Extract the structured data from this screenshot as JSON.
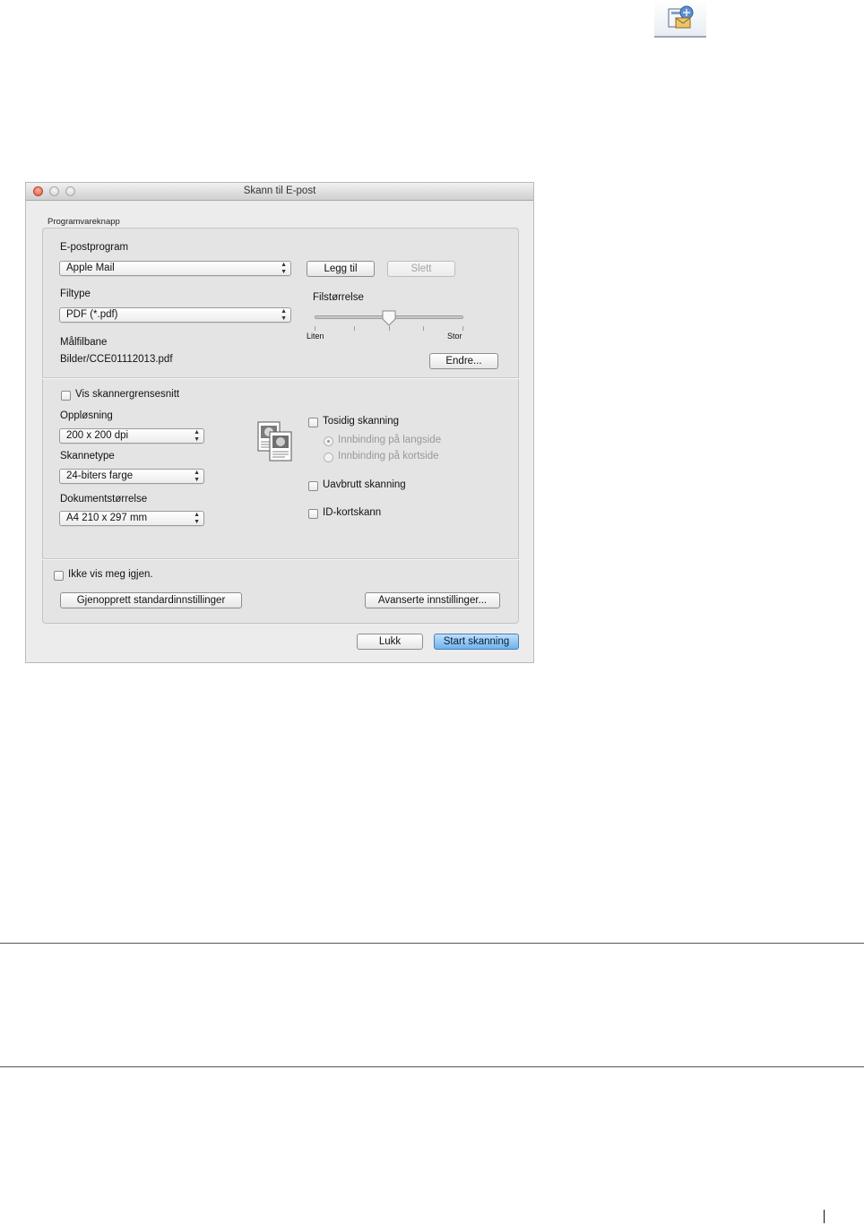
{
  "dialog": {
    "title": "Skann til E-post",
    "group_label": "Programvareknapp",
    "email_program": {
      "label": "E-postprogram",
      "value": "Apple Mail",
      "add_button": "Legg til",
      "delete_button": "Slett"
    },
    "file_type": {
      "label": "Filtype",
      "value": "PDF (*.pdf)"
    },
    "file_size": {
      "label": "Filstørrelse",
      "min_label": "Liten",
      "max_label": "Stor",
      "level_fraction": 0.5
    },
    "target_path": {
      "label": "Målfilbane",
      "value": "Bilder/CCE01112013.pdf",
      "change_button": "Endre..."
    },
    "show_scanner_interface": {
      "label": "Vis skannergrensesnitt",
      "checked": false
    },
    "resolution": {
      "label": "Oppløsning",
      "value": "200 x 200 dpi"
    },
    "scan_type": {
      "label": "Skannetype",
      "value": "24-biters farge"
    },
    "document_size": {
      "label": "Dokumentstørrelse",
      "value": "A4 210 x 297 mm"
    },
    "duplex": {
      "label": "Tosidig skanning",
      "checked": false,
      "long_edge": "Innbinding på langside",
      "short_edge": "Innbinding på kortside"
    },
    "continuous_scan": {
      "label": "Uavbrutt skanning",
      "checked": false
    },
    "id_card_scan": {
      "label": "ID-kortskann",
      "checked": false
    },
    "dont_show_again": {
      "label": "Ikke vis meg igjen.",
      "checked": false
    },
    "restore_defaults_button": "Gjenopprett standardinnstillinger",
    "advanced_button": "Avanserte innstillinger...",
    "close_button": "Lukk",
    "start_button": "Start skanning"
  },
  "colors": {
    "default_button": "#6fb2ef",
    "window_background": "#ececec"
  },
  "icons": {
    "toolbar": "scan-to-email-icon",
    "document": "duplex-document-icon"
  }
}
